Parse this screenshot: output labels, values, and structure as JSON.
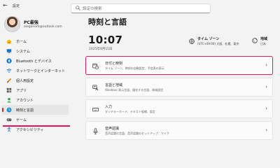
{
  "app": {
    "title": "設定",
    "back_glyph": "←"
  },
  "search": {
    "placeholder": "設定の検索"
  },
  "user": {
    "name": "PC最強",
    "email": "oieganom@outlook.com"
  },
  "sidebar": {
    "items": [
      {
        "label": "ホーム",
        "icon": "home-icon"
      },
      {
        "label": "システム",
        "icon": "monitor-icon"
      },
      {
        "label": "Bluetooth とデバイス",
        "icon": "bluetooth-icon"
      },
      {
        "label": "ネットワークとインターネット",
        "icon": "wifi-icon"
      },
      {
        "label": "個人用設定",
        "icon": "brush-icon"
      },
      {
        "label": "アプリ",
        "icon": "apps-icon"
      },
      {
        "label": "アカウント",
        "icon": "account-icon"
      },
      {
        "label": "時刻と言語",
        "icon": "globe-clock-icon",
        "active": true
      },
      {
        "label": "ゲーム",
        "icon": "game-icon"
      },
      {
        "label": "アクセシビリティ",
        "icon": "accessibility-icon"
      }
    ]
  },
  "main": {
    "title": "時刻と言語",
    "time": "10:07",
    "date": "2025年9月15日",
    "timezone": {
      "title": "タイム ゾーン",
      "value": "(UTC+09:00) 大阪、札幌、東京"
    },
    "region": {
      "title": "地域",
      "value": "日本"
    },
    "cards": [
      {
        "title": "日付と時刻",
        "desc": "タイム ゾーン、時刻の自動設定、予定表の表示",
        "icon": "calendar-clock-icon",
        "highlight": true
      },
      {
        "title": "言語と地域",
        "desc": "Windows 表示言語、優先する言語、地域設定",
        "icon": "language-icon"
      },
      {
        "title": "入力",
        "desc": "タッチキーボード、テキスト候補、設定",
        "icon": "keyboard-icon"
      },
      {
        "title": "音声認識",
        "desc": "音声認識の言語、音声認識のセットアップ、マイク",
        "icon": "microphone-icon"
      }
    ]
  },
  "colors": {
    "accent": "#e0185a",
    "active_pill": "#c42b2b"
  }
}
